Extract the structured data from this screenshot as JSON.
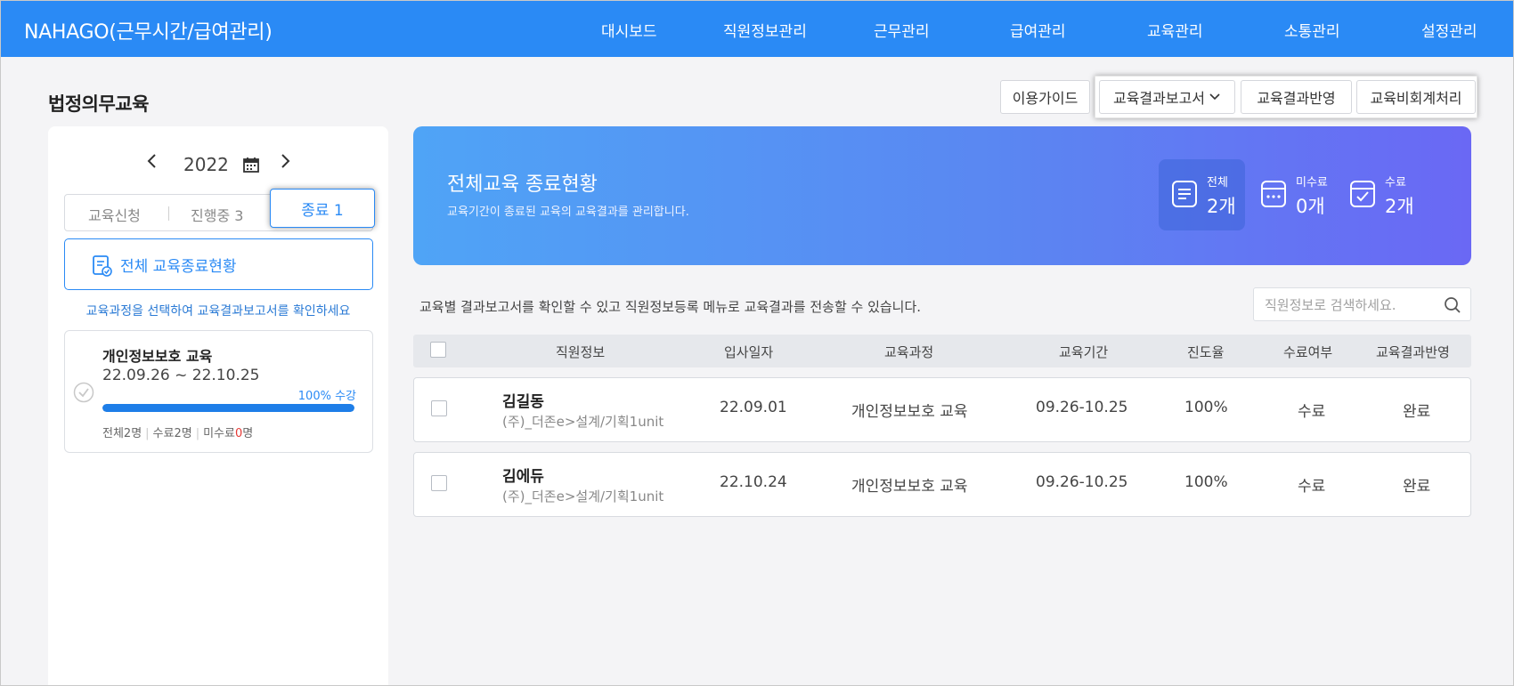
{
  "header": {
    "brand": "NAHAGO(근무시간/급여관리)",
    "nav": [
      "대시보드",
      "직원정보관리",
      "근무관리",
      "급여관리",
      "교육관리",
      "소통관리",
      "설정관리"
    ]
  },
  "page": {
    "title": "법정의무교육",
    "buttons": {
      "guide": "이용가이드",
      "report": "교육결과보고서",
      "apply": "교육결과반영",
      "expense": "교육비회계처리"
    }
  },
  "left": {
    "year": "2022",
    "tabs": {
      "apply": "교육신청",
      "ongoing": "진행중 3",
      "done": "종료 1"
    },
    "all_status_label": "전체 교육종료현황",
    "hint": "교육과정을 선택하여 교육결과보고서를 확인하세요",
    "course": {
      "name": "개인정보보호 교육",
      "dates": "22.09.26 ~ 22.10.25",
      "progress_label": "100% 수강",
      "progress": 1.0,
      "stat_total": "전체2명",
      "stat_done": "수료2명",
      "stat_undone_prefix": "미수료",
      "stat_undone_count": "0",
      "stat_undone_suffix": "명"
    }
  },
  "banner": {
    "title": "전체교육 종료현황",
    "subtitle": "교육기간이 종료된 교육의 교육결과를 관리합니다.",
    "stats": [
      {
        "label": "전체",
        "value": "2개",
        "icon": "list-doc-icon"
      },
      {
        "label": "미수료",
        "value": "0개",
        "icon": "pending-doc-icon"
      },
      {
        "label": "수료",
        "value": "2개",
        "icon": "check-doc-icon"
      }
    ]
  },
  "description": "교육별 결과보고서를 확인할 수 있고 직원정보등록 메뉴로 교육결과를 전송할 수 있습니다.",
  "search": {
    "placeholder": "직원정보로 검색하세요."
  },
  "table": {
    "headers": [
      "직원정보",
      "입사일자",
      "교육과정",
      "교육기간",
      "진도율",
      "수료여부",
      "교육결과반영"
    ],
    "rows": [
      {
        "name": "김길동",
        "org": "(주)_더존e>설계/기획1unit",
        "hire_date": "22.09.01",
        "course": "개인정보보호 교육",
        "period": "09.26-10.25",
        "progress": "100%",
        "completed": "수료",
        "applied": "완료"
      },
      {
        "name": "김에듀",
        "org": "(주)_더존e>설계/기획1unit",
        "hire_date": "22.10.24",
        "course": "개인정보보호 교육",
        "period": "09.26-10.25",
        "progress": "100%",
        "completed": "수료",
        "applied": "완료"
      }
    ]
  },
  "colors": {
    "primary": "#2a8af5",
    "banner_start": "#4fa4f6",
    "banner_end": "#6a68f4",
    "undone_red": "#e53935"
  }
}
